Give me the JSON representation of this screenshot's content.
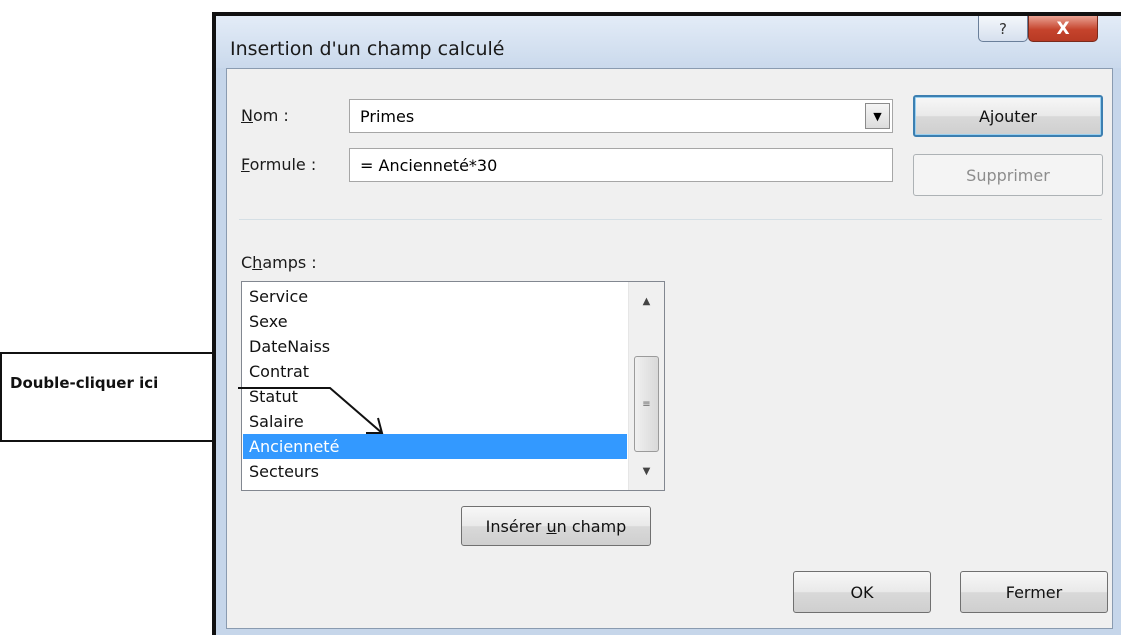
{
  "dialog": {
    "title": "Insertion d'un champ calculé",
    "help_glyph": "?",
    "close_glyph": "X"
  },
  "form": {
    "name_label": "Nom :",
    "name_value": "Primes",
    "formula_label": "Formule :",
    "formula_value": "= Ancienneté*30",
    "fields_label": "Champs :"
  },
  "buttons": {
    "add": "Ajouter",
    "delete": "Supprimer",
    "insert_field": "Insérer un champ",
    "ok": "OK",
    "close": "Fermer"
  },
  "fields": [
    {
      "label": "Service",
      "selected": false
    },
    {
      "label": "Sexe",
      "selected": false
    },
    {
      "label": "DateNaiss",
      "selected": false
    },
    {
      "label": "Contrat",
      "selected": false
    },
    {
      "label": "Statut",
      "selected": false
    },
    {
      "label": "Salaire",
      "selected": false
    },
    {
      "label": "Ancienneté",
      "selected": true
    },
    {
      "label": "Secteurs",
      "selected": false
    }
  ],
  "callout": {
    "text": "Double-cliquer ici"
  },
  "colors": {
    "selection": "#3399ff",
    "close_button": "#c5432c"
  }
}
